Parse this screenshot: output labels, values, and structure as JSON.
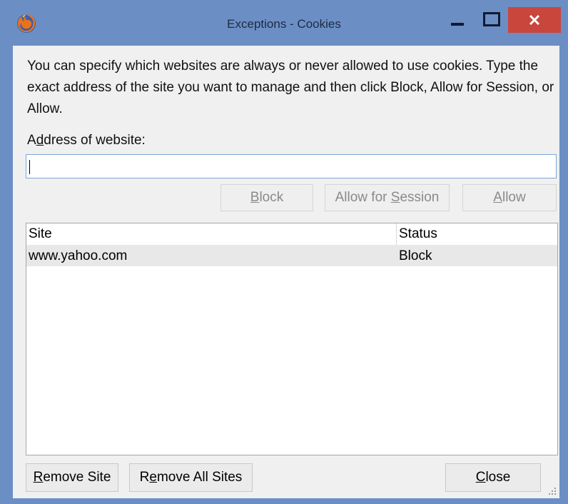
{
  "window": {
    "title": "Exceptions - Cookies",
    "icon": "firefox-icon",
    "controls": {
      "minimize": "minimize-icon",
      "maximize": "maximize-icon",
      "close": "close-icon"
    },
    "colors": {
      "frame": "#6b8fc4",
      "close": "#c9463d",
      "client": "#f0f0f0"
    }
  },
  "intro_text": "You can specify which websites are always or never allowed to use cookies. Type the exact address of the site you want to manage and then click Block, Allow for Session, or Allow.",
  "address": {
    "label_pre": "A",
    "label_mnemonic": "d",
    "label_post": "dress of website:",
    "value": ""
  },
  "buttons": {
    "block": {
      "pre": "",
      "mn": "B",
      "post": "lock"
    },
    "allow_session": {
      "pre": "Allow for ",
      "mn": "S",
      "post": "ession"
    },
    "allow": {
      "pre": "",
      "mn": "A",
      "post": "llow"
    },
    "remove_site": {
      "pre": "",
      "mn": "R",
      "post": "emove Site"
    },
    "remove_all": {
      "pre": "R",
      "mn": "e",
      "post": "move All Sites"
    },
    "close": {
      "pre": "",
      "mn": "C",
      "post": "lose"
    }
  },
  "table": {
    "columns": [
      "Site",
      "Status"
    ],
    "rows": [
      {
        "site": "www.yahoo.com",
        "status": "Block"
      }
    ]
  }
}
